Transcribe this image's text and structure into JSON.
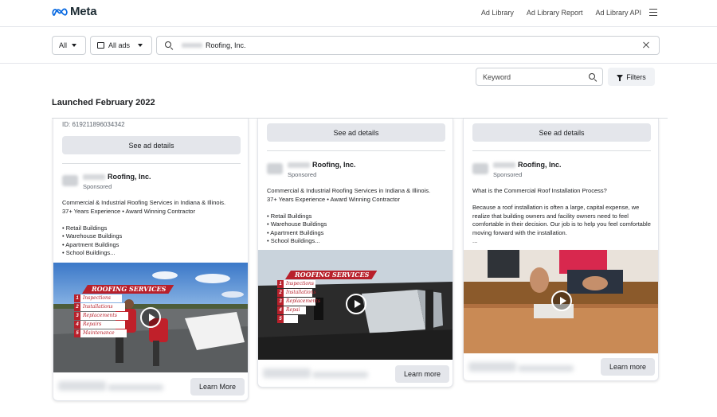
{
  "nav": {
    "logo_text": "Meta",
    "links": [
      "Ad Library",
      "Ad Library Report",
      "Ad Library API"
    ]
  },
  "filters": {
    "country": "All",
    "ad_type": "All ads",
    "search_value": "Roofing, Inc.",
    "keyword_placeholder": "Keyword",
    "filters_label": "Filters"
  },
  "section": {
    "launched": "Launched February 2022"
  },
  "cards": [
    {
      "library_id": "ID: 619211896034342",
      "details_label": "See ad details",
      "advertiser": "Roofing, Inc.",
      "sponsored": "Sponsored",
      "body": "Commercial & Industrial Roofing Services in Indiana & Illinois.\n37+ Years Experience • Award Winning Contractor\n\n• Retail Buildings\n• Warehouse Buildings\n• Apartment Buildings\n• School Buildings...",
      "video_banner": "ROOFING SERVICES",
      "video_list": [
        "Inspections",
        "Installations",
        "Replacements",
        "Repairs",
        "Maintenance"
      ],
      "cta": "Learn More"
    },
    {
      "details_label": "See ad details",
      "advertiser": "Roofing, Inc.",
      "sponsored": "Sponsored",
      "body": "Commercial & Industrial Roofing Services in Indiana & Illinois.\n37+ Years Experience • Award Winning Contractor\n\n• Retail Buildings\n• Warehouse Buildings\n• Apartment Buildings\n• School Buildings...",
      "video_banner": "ROOFING SERVICES",
      "video_list": [
        "Inspections",
        "Installations",
        "Replacements",
        "Repai",
        ""
      ],
      "cta": "Learn more"
    },
    {
      "details_label": "See ad details",
      "advertiser": "Roofing, Inc.",
      "sponsored": "Sponsored",
      "body": "What is the Commercial Roof Installation Process?\n\nBecause a roof installation is often a large, capital expense, we realize that building owners and facility owners need to feel comfortable in their decision. Our job is to help you feel comfortable moving forward with the installation.\n...",
      "cta": "Learn more"
    }
  ],
  "colors": {
    "meta_blue": "#0668E1",
    "banner_red": "#b8202b",
    "button_gray": "#e4e6eb"
  }
}
